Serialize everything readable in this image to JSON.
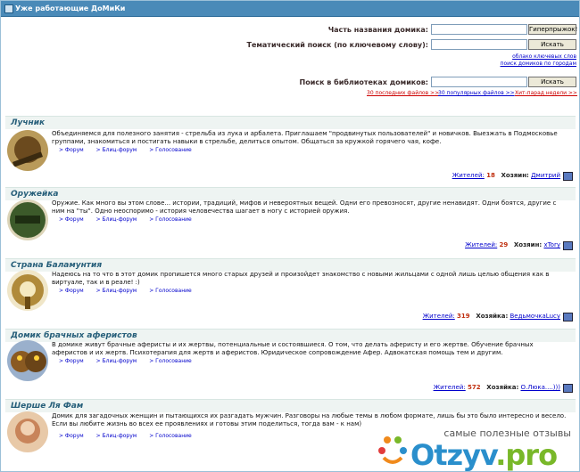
{
  "header": {
    "title": "Уже работающие ДоМиКи"
  },
  "search": {
    "name_label": "Часть названия домика:",
    "name_button": "Гиперпрыжок!",
    "theme_label": "Тематический поиск (по ключевому слову):",
    "theme_button": "Искать",
    "cloud_link": "облако ключевых слов",
    "dir_link": "поиск домиков по городам",
    "lib_label": "Поиск в библиотеках домиков:",
    "lib_button": "Искать",
    "last_files": "30 последних файлов >>",
    "popular_files": "30 популярных файлов >>",
    "hit_parade": "Хит-парад недели >>"
  },
  "links": {
    "forum": "> Форум",
    "blitz": "> Блиц-форум",
    "vote": "> Голосование"
  },
  "houses": [
    {
      "name": "Лучник",
      "desc": "Объединяемся для полезного занятия - стрельба из лука и арбалета. Приглашаем \"продвинутых пользователей\" и новичков. Выезжать в Подмосковье группами, знакомиться и постигать навыки в стрельбе, делиться опытом. Общаться за кружкой горячего чая, кофе.",
      "residents_label": "Жителей:",
      "residents": "18",
      "owner_label": "Хозяин:",
      "owner": "Дмитрий",
      "color": "#6b4a1e"
    },
    {
      "name": "Оружейка",
      "desc": "Оружие. Как много вы этом слове... истории, традиций, мифов и невероятных вещей. Одни его превозносят, другие ненавидят. Одни боятся, другие с ним на \"ты\". Одно неоспоримо - история человечества шагает в ногу с историей оружия.",
      "residents_label": "Жителей:",
      "residents": "29",
      "owner_label": "Хозяин:",
      "owner": "xTory",
      "color": "#3c5a2a"
    },
    {
      "name": "Страна Баламунтия",
      "desc": "Надеюсь на то что в этот домик пропишется много старых друзей и произойдет знакомство с новыми жильцами с одной лишь целью общения как в виртуале, так и в реале! :)",
      "residents_label": "Жителей:",
      "residents": "319",
      "owner_label": "Хозяйка:",
      "owner": "ВедьмочкаLucy",
      "color": "#b08a3a"
    },
    {
      "name": "Домик брачных аферистов",
      "desc": "В домике живут брачные аферисты и их жертвы, потенциальные и состоявшиеся. О том, что делать аферисту и его жертве. Обучение брачных аферистов и их жертв. Психотерапия для жертв и аферистов. Юридическое сопровождение Афер. Адвокатская помощь тем и другим.",
      "residents_label": "Жителей:",
      "residents": "572",
      "owner_label": "Хозяйка:",
      "owner": "О.Люка....)))",
      "color": "#2a3a5a"
    },
    {
      "name": "Шерше Ля Фам",
      "desc": "Домик для загадочных женщин и пытающихся их разгадать мужчин. Разговоры на любые темы в любом формате, лишь бы это было интересно и весело. Если вы любите жизнь во всех ее проявлениях и готовы этим поделиться, тогда вам - к нам)",
      "residents_label": "",
      "residents": "",
      "owner_label": "",
      "owner": "",
      "color": "#c8845a"
    }
  ],
  "watermark": {
    "tagline": "самые полезные отзывы",
    "logo_a": "Otzyv",
    "logo_b": ".pro"
  }
}
